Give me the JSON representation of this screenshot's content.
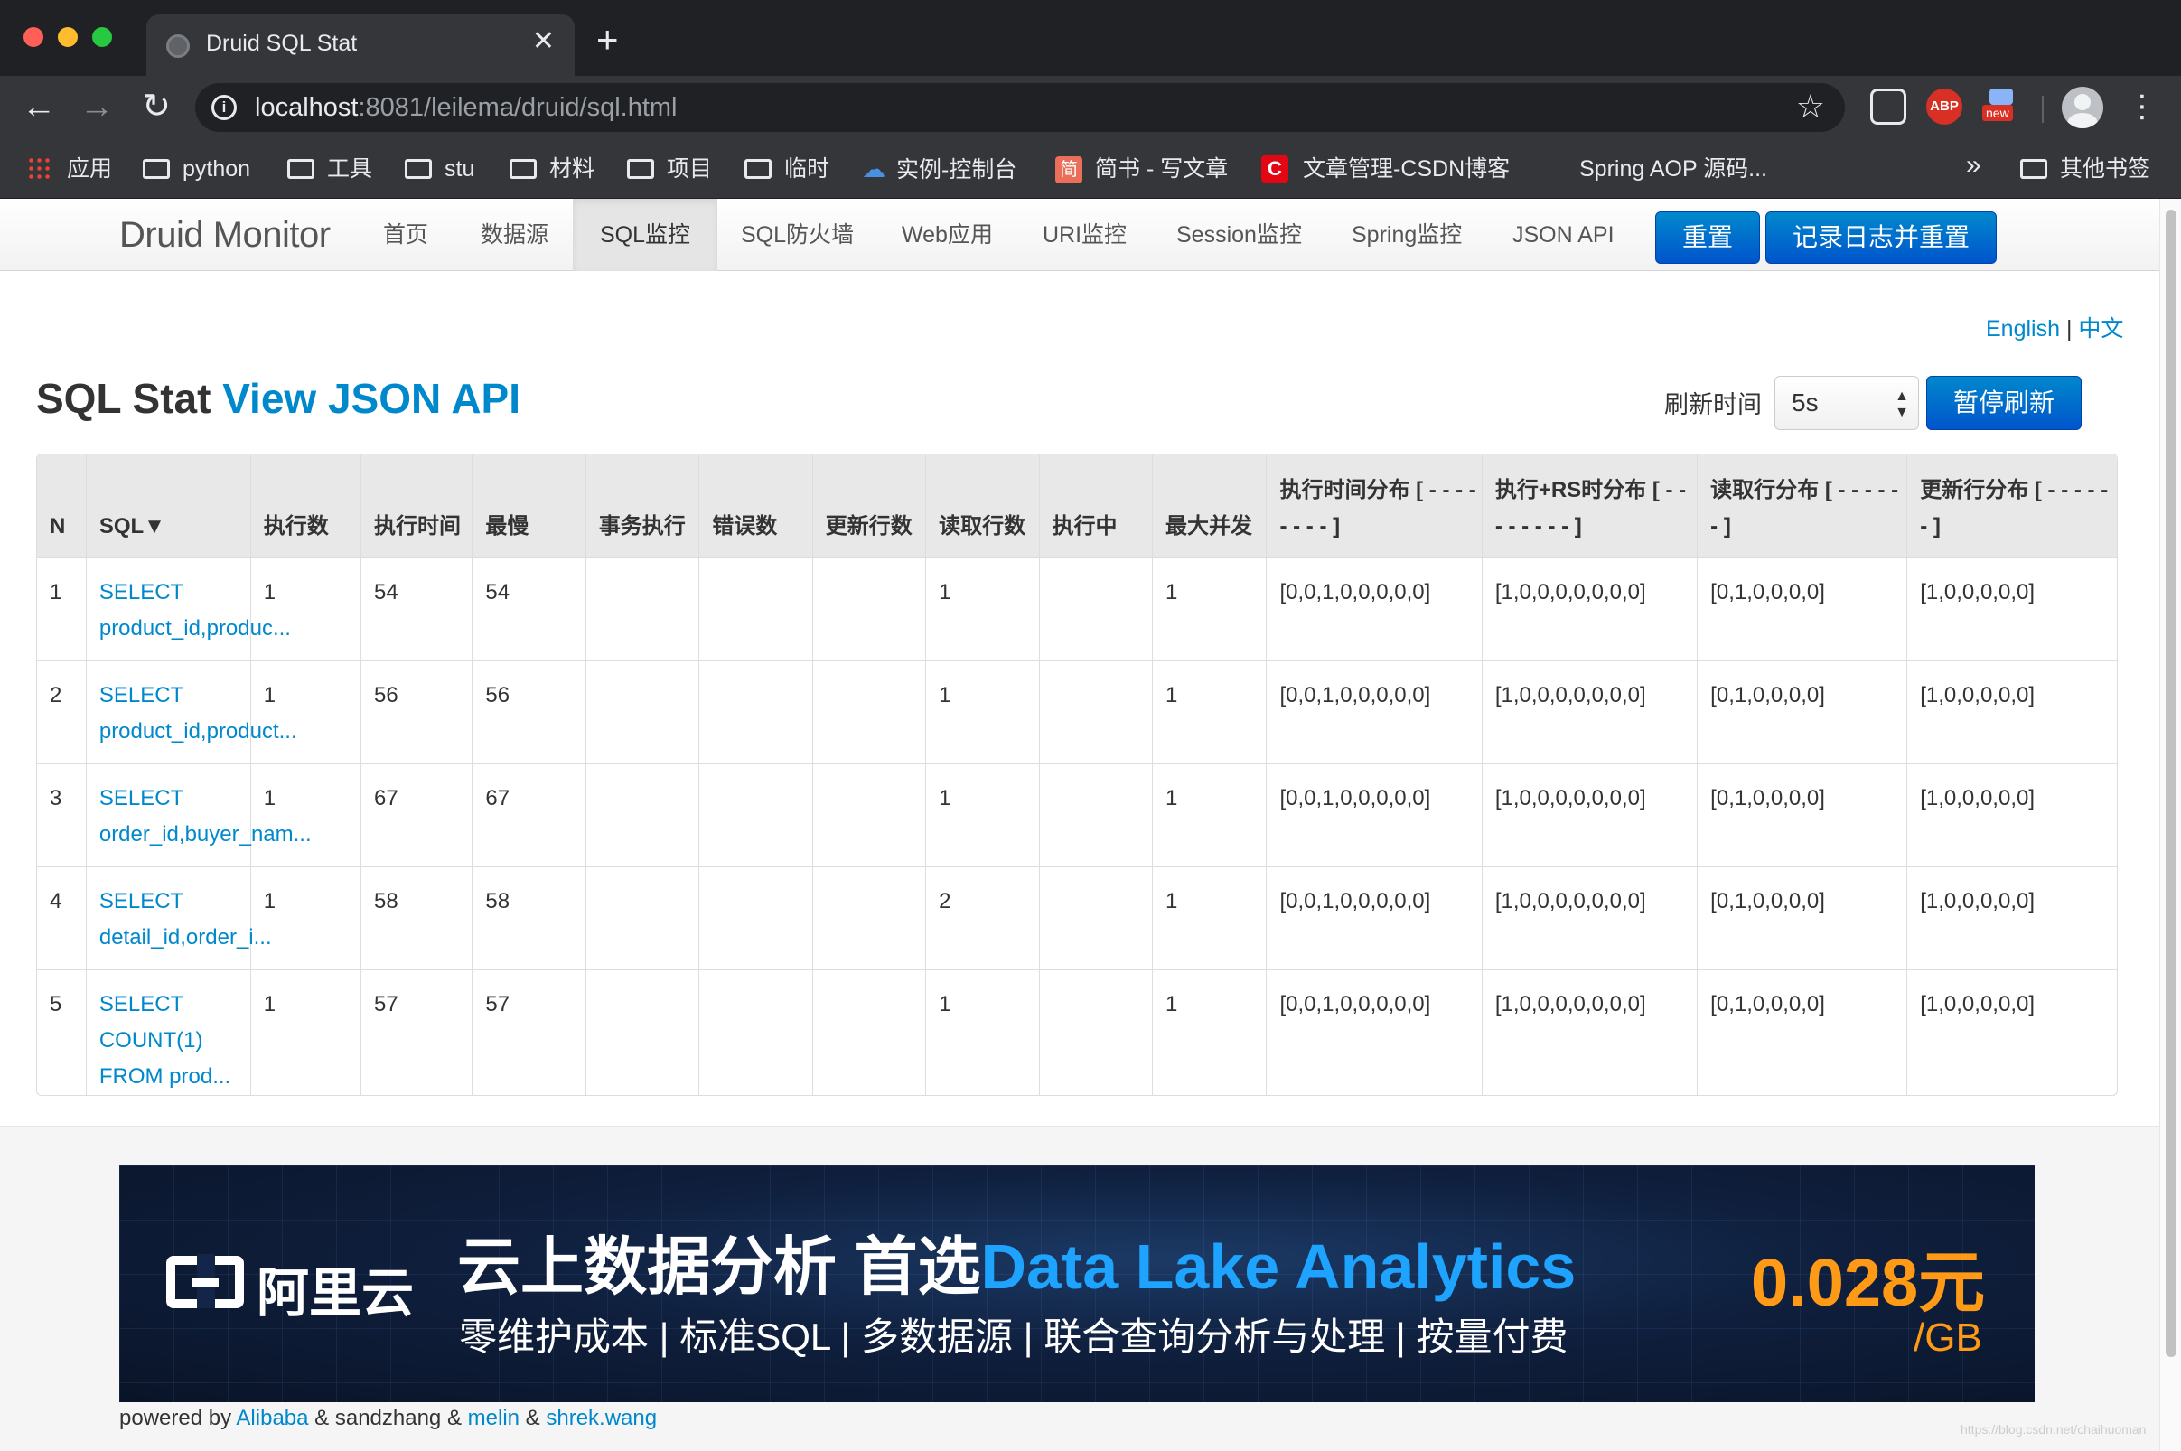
{
  "browser": {
    "tab_title": "Druid SQL Stat",
    "tab_close": "✕",
    "new_tab": "+",
    "url_host": "localhost",
    "url_rest": ":8081/leilema/druid/sql.html",
    "ext_abp": "ABP",
    "ext_new": "new",
    "bookmarks": [
      "应用",
      "python",
      "工具",
      "stu",
      "材料",
      "项目",
      "临时",
      "实例-控制台",
      "简书 - 写文章",
      "文章管理-CSDN博客",
      "Spring AOP 源码...",
      "其他书签"
    ],
    "bookmark_more": "»",
    "jian_icon_text": "简",
    "csdn_icon_text": "C"
  },
  "navbar": {
    "brand": "Druid Monitor",
    "items": [
      "首页",
      "数据源",
      "SQL监控",
      "SQL防火墙",
      "Web应用",
      "URI监控",
      "Session监控",
      "Spring监控",
      "JSON API"
    ],
    "active_index": 2,
    "reset_label": "重置",
    "log_reset_label": "记录日志并重置"
  },
  "lang": {
    "english": "English",
    "sep": "|",
    "chinese": "中文"
  },
  "header": {
    "title": "SQL Stat",
    "api_link": "View JSON API",
    "refresh_label": "刷新时间",
    "refresh_value": "5s",
    "pause_label": "暂停刷新"
  },
  "table": {
    "headers": [
      "N",
      "SQL▼",
      "执行数",
      "执行时间",
      "最慢",
      "事务执行",
      "错误数",
      "更新行数",
      "读取行数",
      "执行中",
      "最大并发",
      "执行时间分布 [ - - - - - - - - ]",
      "执行+RS时分布 [ - - - - - - - - ]",
      "读取行分布 [ - - - - - - ]",
      "更新行分布 [ - - - - - - ]"
    ],
    "rows": [
      {
        "n": "1",
        "sql_line1": "SELECT",
        "sql_line2": "product_id,produc...",
        "exec": "1",
        "time": "54",
        "slowest": "54",
        "txn": "",
        "err": "",
        "upd": "",
        "read": "1",
        "running": "",
        "maxcon": "1",
        "time_dist": "[0,0,1,0,0,0,0,0]",
        "rs_dist": "[1,0,0,0,0,0,0,0]",
        "read_dist": "[0,1,0,0,0,0]",
        "upd_dist": "[1,0,0,0,0,0]"
      },
      {
        "n": "2",
        "sql_line1": "SELECT",
        "sql_line2": "product_id,product...",
        "exec": "1",
        "time": "56",
        "slowest": "56",
        "txn": "",
        "err": "",
        "upd": "",
        "read": "1",
        "running": "",
        "maxcon": "1",
        "time_dist": "[0,0,1,0,0,0,0,0]",
        "rs_dist": "[1,0,0,0,0,0,0,0]",
        "read_dist": "[0,1,0,0,0,0]",
        "upd_dist": "[1,0,0,0,0,0]"
      },
      {
        "n": "3",
        "sql_line1": "SELECT",
        "sql_line2": "order_id,buyer_nam...",
        "exec": "1",
        "time": "67",
        "slowest": "67",
        "txn": "",
        "err": "",
        "upd": "",
        "read": "1",
        "running": "",
        "maxcon": "1",
        "time_dist": "[0,0,1,0,0,0,0,0]",
        "rs_dist": "[1,0,0,0,0,0,0,0]",
        "read_dist": "[0,1,0,0,0,0]",
        "upd_dist": "[1,0,0,0,0,0]"
      },
      {
        "n": "4",
        "sql_line1": "SELECT",
        "sql_line2": "detail_id,order_i...",
        "exec": "1",
        "time": "58",
        "slowest": "58",
        "txn": "",
        "err": "",
        "upd": "",
        "read": "2",
        "running": "",
        "maxcon": "1",
        "time_dist": "[0,0,1,0,0,0,0,0]",
        "rs_dist": "[1,0,0,0,0,0,0,0]",
        "read_dist": "[0,1,0,0,0,0]",
        "upd_dist": "[1,0,0,0,0,0]"
      },
      {
        "n": "5",
        "sql_line1": "SELECT COUNT(1)",
        "sql_line2": "FROM prod...",
        "exec": "1",
        "time": "57",
        "slowest": "57",
        "txn": "",
        "err": "",
        "upd": "",
        "read": "1",
        "running": "",
        "maxcon": "1",
        "time_dist": "[0,0,1,0,0,0,0,0]",
        "rs_dist": "[1,0,0,0,0,0,0,0]",
        "read_dist": "[0,1,0,0,0,0]",
        "upd_dist": "[1,0,0,0,0,0]"
      }
    ]
  },
  "banner": {
    "brand": "阿里云",
    "title_prefix": "云上数据分析 首选",
    "title_highlight": "Data Lake Analytics",
    "subtitle": "零维护成本 | 标准SQL | 多数据源 | 联合查询分析与处理 | 按量付费",
    "price": "0.028元",
    "unit": "/GB"
  },
  "footer": {
    "powered_prefix": "powered by",
    "alibaba": "Alibaba",
    "amp1": "&",
    "sandzhang": "sandzhang",
    "amp2": "&",
    "melin": "melin",
    "amp3": "&",
    "shrek": "shrek.wang",
    "watermark": "https://blog.csdn.net/chaihuoman"
  },
  "colors": {
    "link": "#0088cc",
    "primary_button": "#0066cc",
    "price": "#ff9a16",
    "banner_highlight": "#1ea4ff"
  }
}
